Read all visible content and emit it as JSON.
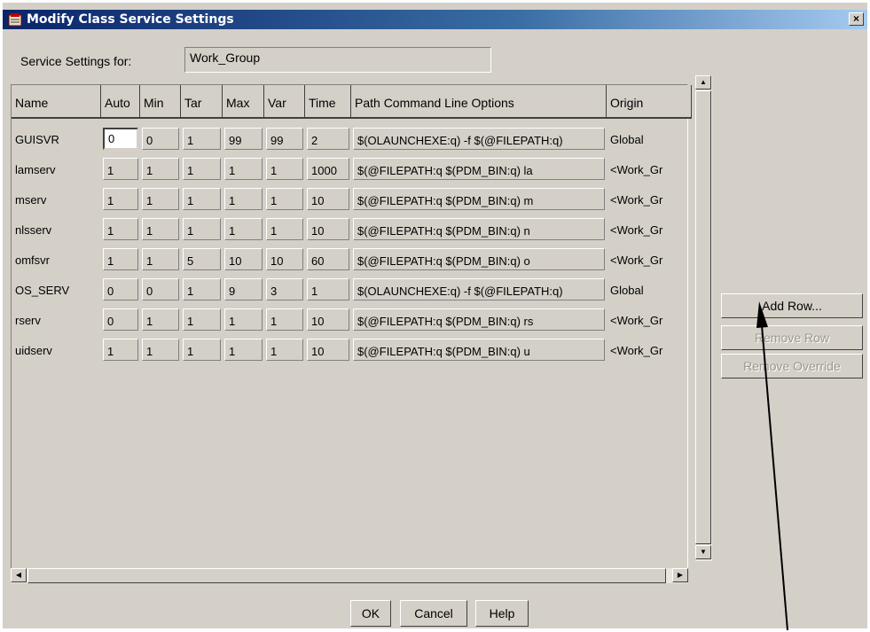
{
  "window": {
    "title": "Modify Class Service Settings",
    "close": "×"
  },
  "settings_for": {
    "label": "Service Settings for:",
    "value": "Work_Group"
  },
  "columns": [
    "Name",
    "Auto",
    "Min",
    "Tar",
    "Max",
    "Var",
    "Time",
    "Path Command Line Options",
    "Origin"
  ],
  "rows": [
    [
      "GUISVR",
      "0",
      "0",
      "1",
      "99",
      "99",
      "2",
      "$(OLAUNCHEXE:q) -f $(@FILEPATH:q)",
      "Global"
    ],
    [
      "lamserv",
      "1",
      "1",
      "1",
      "1",
      "1",
      "1000",
      "$(@FILEPATH:q $(PDM_BIN:q) la",
      "<Work_Gr"
    ],
    [
      "mserv",
      "1",
      "1",
      "1",
      "1",
      "1",
      "10",
      "$(@FILEPATH:q $(PDM_BIN:q) m",
      "<Work_Gr"
    ],
    [
      "nlsserv",
      "1",
      "1",
      "1",
      "1",
      "1",
      "10",
      "$(@FILEPATH:q $(PDM_BIN:q) n",
      "<Work_Gr"
    ],
    [
      "omfsvr",
      "1",
      "1",
      "5",
      "10",
      "10",
      "60",
      "$(@FILEPATH:q $(PDM_BIN:q) o",
      "<Work_Gr"
    ],
    [
      "OS_SERV",
      "0",
      "0",
      "1",
      "9",
      "3",
      "1",
      "$(OLAUNCHEXE:q) -f $(@FILEPATH:q)",
      "Global"
    ],
    [
      "rserv",
      "0",
      "1",
      "1",
      "1",
      "1",
      "10",
      "$(@FILEPATH:q $(PDM_BIN:q) rs",
      "<Work_Gr"
    ],
    [
      "uidserv",
      "1",
      "1",
      "1",
      "1",
      "1",
      "10",
      "$(@FILEPATH:q $(PDM_BIN:q) u",
      "<Work_Gr"
    ]
  ],
  "side_buttons": {
    "add": "Add Row...",
    "remove": "Remove Row",
    "remove_override": "Remove Override"
  },
  "dialog_buttons": {
    "ok": "OK",
    "cancel": "Cancel",
    "help": "Help"
  },
  "scroll_arrows": {
    "up": "▲",
    "down": "▼",
    "left": "◀",
    "right": "▶"
  }
}
